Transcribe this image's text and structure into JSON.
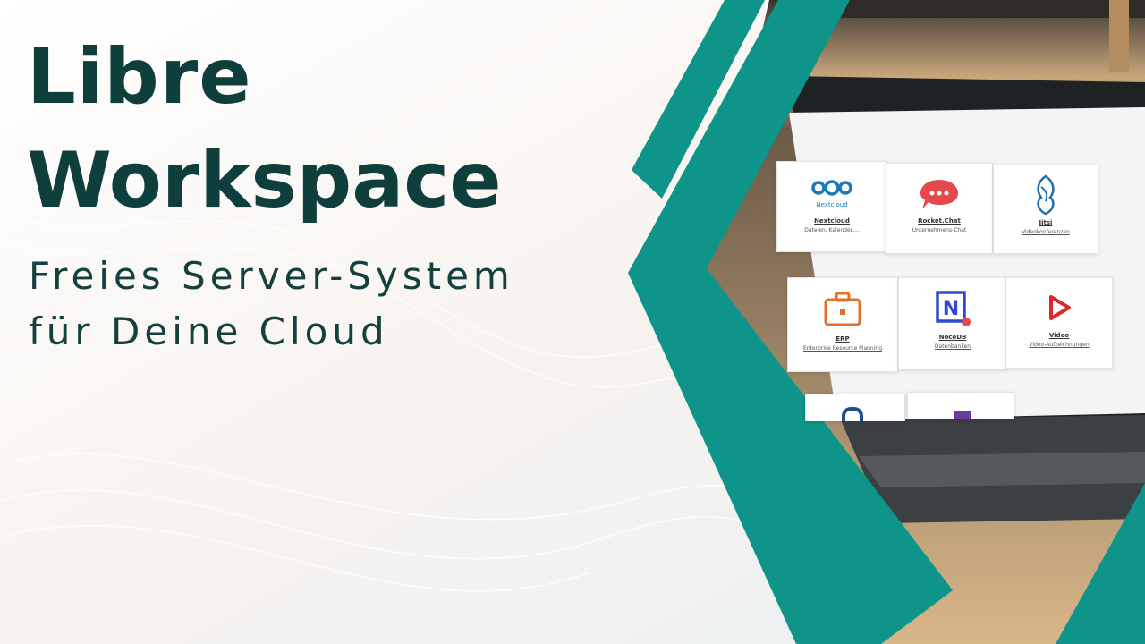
{
  "headline": {
    "line1": "Libre",
    "line2": "Workspace"
  },
  "subtitle": {
    "line1": "Freies Server-System",
    "line2": "für Deine Cloud"
  },
  "colors": {
    "teal": "#0e9488",
    "title": "#0f3f3c"
  },
  "screen_apps": [
    {
      "name": "Nextcloud",
      "description": "Dateien, Kalender,...",
      "icon": "nextcloud-icon",
      "icon_label": "Nextcloud"
    },
    {
      "name": "Rocket.Chat",
      "description": "Unternehmens-Chat",
      "icon": "chat-bubble-icon"
    },
    {
      "name": "Jitsi",
      "description": "Videokonferenzen",
      "icon": "jitsi-icon"
    },
    {
      "name": "ERP",
      "description": "Enterprise Resource Planning",
      "icon": "briefcase-icon"
    },
    {
      "name": "NocoDB",
      "description": "Datenbanken",
      "icon": "nocodb-icon"
    },
    {
      "name": "Video",
      "description": "Video-Aufzeichnungen",
      "icon": "play-icon"
    }
  ]
}
